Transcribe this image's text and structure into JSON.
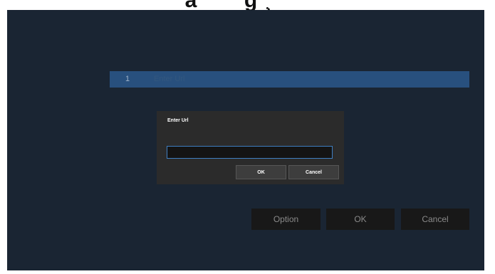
{
  "header": {
    "title": "ä ¨ ‘ ’ g ¸ ’ ’ ‘"
  },
  "list": {
    "number": "1",
    "label": "Enter Url"
  },
  "dialog": {
    "title": "Enter Url",
    "input_value": "",
    "ok_label": "OK",
    "cancel_label": "Cancel"
  },
  "footer": {
    "option_label": "Option",
    "ok_label": "OK",
    "cancel_label": "Cancel"
  },
  "colors": {
    "screen_bg": "#1a2533",
    "list_highlight": "#28507e",
    "dialog_bg": "#2b2b2b",
    "input_border": "#3f7fc2",
    "button_bg": "#181818"
  }
}
